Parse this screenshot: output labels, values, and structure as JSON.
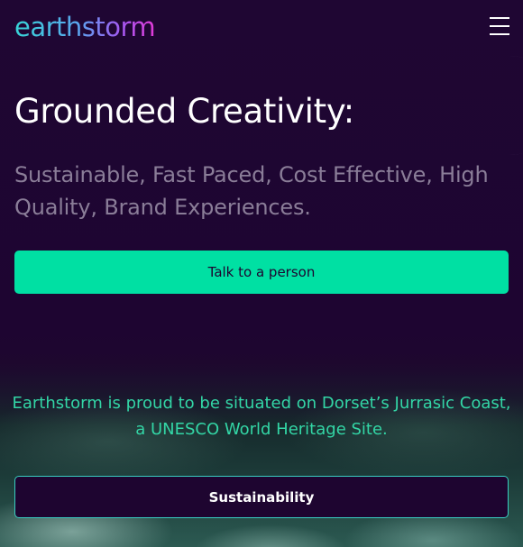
{
  "header": {
    "logo_text": "earthstorm",
    "menu_icon": "hamburger-menu-icon"
  },
  "hero": {
    "title": "Grounded Creativity:",
    "subtitle": "Sustainable, Fast Paced, Cost Effective, High Quality, Brand Experiences.",
    "cta_label": "Talk to a person"
  },
  "coast": {
    "text": "Earthstorm is proud to be situated on Dorset’s Jurrasic Coast, a UNESCO World Heritage Site.",
    "button_label": "Sustainability"
  },
  "colors": {
    "background": "#1e0530",
    "accent_green": "#00e0a3",
    "text_teal": "#33d6a6",
    "subtitle_muted": "#8a7d98",
    "outline_teal": "#39cdc1"
  }
}
